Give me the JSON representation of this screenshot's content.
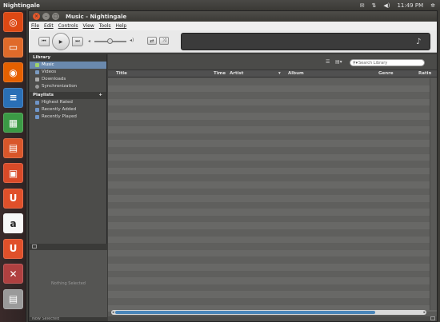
{
  "top_panel": {
    "title": "Nightingale",
    "clock": "11:49 PM",
    "indicators": [
      "mail-icon",
      "keyboard-arrows-icon",
      "speaker-icon",
      "gear-icon"
    ]
  },
  "launcher": {
    "items": [
      {
        "name": "ubuntu-dash-icon",
        "color": "#dd4814",
        "glyph": "◎"
      },
      {
        "name": "files-icon",
        "color": "#e06a2a",
        "glyph": "▭"
      },
      {
        "name": "firefox-icon",
        "color": "#e66000",
        "glyph": "◉"
      },
      {
        "name": "writer-icon",
        "color": "#2a6fb6",
        "glyph": "≡"
      },
      {
        "name": "calc-icon",
        "color": "#3b9a45",
        "glyph": "▦"
      },
      {
        "name": "impress-icon",
        "color": "#d9562a",
        "glyph": "▤"
      },
      {
        "name": "software-center-icon",
        "color": "#d94a28",
        "glyph": "▣"
      },
      {
        "name": "ubuntu-one-icon",
        "color": "#e0502a",
        "glyph": "U"
      },
      {
        "name": "amazon-icon",
        "color": "#f7f7f7",
        "glyph": "a"
      },
      {
        "name": "ubuntu-one-music-icon",
        "color": "#e0502a",
        "glyph": "U"
      },
      {
        "name": "system-settings-icon",
        "color": "#b04040",
        "glyph": "✕"
      },
      {
        "name": "trash-icon",
        "color": "#9a9a9a",
        "glyph": "▤"
      }
    ]
  },
  "window": {
    "title": "Music - Nightingale"
  },
  "menu": [
    "File",
    "Edit",
    "Controls",
    "View",
    "Tools",
    "Help"
  ],
  "sidebar": {
    "library_header": "Library",
    "library_items": [
      {
        "label": "Music",
        "selected": true,
        "icon": "music-note-icon"
      },
      {
        "label": "Videos",
        "selected": false,
        "icon": "film-icon"
      },
      {
        "label": "Downloads",
        "selected": false,
        "icon": "download-icon"
      },
      {
        "label": "Synchronization",
        "selected": false,
        "icon": "sync-icon"
      }
    ],
    "playlists_header": "Playlists",
    "playlists_add": "+",
    "playlists": [
      {
        "label": "Highest Rated"
      },
      {
        "label": "Recently Added"
      },
      {
        "label": "Recently Played"
      }
    ],
    "artwork_placeholder": "Nothing Selected",
    "footer": "Now Selected"
  },
  "library": {
    "search_placeholder": "Search Library",
    "columns": [
      "Title",
      "Time",
      "Artist",
      "Album",
      "Genre",
      "Ratin"
    ],
    "sort_indicator": "▾"
  },
  "colors": {
    "accent_selection": "#6a89ad",
    "scroll_thumb": "#4a85b8",
    "close_button": "#e2582b"
  }
}
